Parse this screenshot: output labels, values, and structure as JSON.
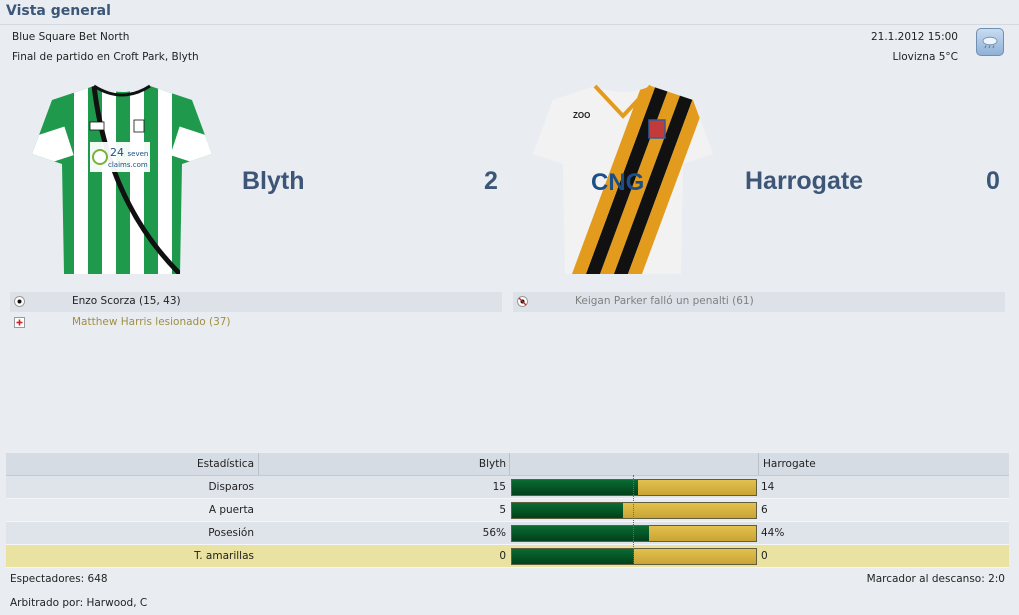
{
  "header": {
    "title": "Vista general"
  },
  "match": {
    "competition": "Blue Square Bet North",
    "venue": "Final de partido en Croft Park, Blyth",
    "datetime": "21.1.2012 15:00",
    "weather": "Llovizna 5°C",
    "weather_icon": "cloud-rain-icon"
  },
  "home": {
    "name": "Blyth",
    "score": "2",
    "kit_colors": {
      "primary": "#1f9a4d",
      "secondary": "#ffffff",
      "trim": "#111111"
    },
    "kit_sponsor": {
      "line1": "24",
      "line2": "seven",
      "line3": "claims.com"
    },
    "events": [
      {
        "icon": "ball-icon",
        "text": "Enzo Scorza (15, 43)"
      },
      {
        "icon": "injury-icon",
        "text": "Matthew Harris lesionado (37)"
      }
    ]
  },
  "away": {
    "name": "Harrogate",
    "score": "0",
    "kit_colors": {
      "primary": "#f2f2f2",
      "stripe1": "#111111",
      "stripe2": "#e39b1e"
    },
    "kit_sponsor": "CNG",
    "kit_brand": "ZOO",
    "events": [
      {
        "icon": "missed-penalty-icon",
        "text": "Keigan Parker falló un penalti (61)"
      }
    ]
  },
  "stats": {
    "headers": {
      "label": "Estadística",
      "home": "Blyth",
      "away": "Harrogate"
    },
    "rows": [
      {
        "label": "Disparos",
        "home": "15",
        "away": "14",
        "home_fraction": 0.517
      },
      {
        "label": "A puerta",
        "home": "5",
        "away": "6",
        "home_fraction": 0.455
      },
      {
        "label": "Posesión",
        "home": "56%",
        "away": "44%",
        "home_fraction": 0.56
      },
      {
        "label": "T. amarillas",
        "home": "0",
        "away": "0",
        "home_fraction": 0.5
      }
    ]
  },
  "footer": {
    "attendance": "Espectadores: 648",
    "referee": "Arbitrado por: Harwood, C",
    "halftime": "Marcador al descanso: 2:0"
  }
}
